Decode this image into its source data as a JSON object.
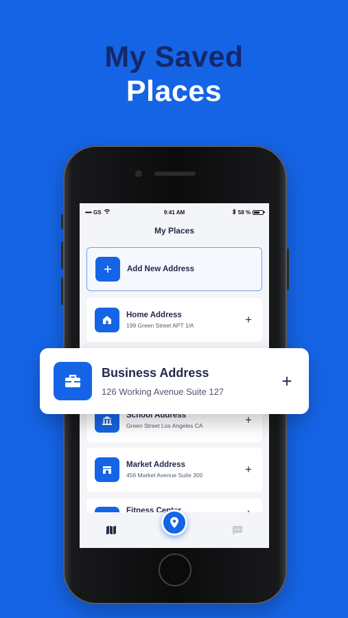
{
  "headline": {
    "line1": "My Saved",
    "line2": "Places"
  },
  "statusbar": {
    "carrier": "GS",
    "signal_dots": "•••••",
    "time": "9:41 AM",
    "battery": "58 %"
  },
  "screen": {
    "title": "My Places"
  },
  "add_card": {
    "label": "Add New Address",
    "icon": "plus-icon"
  },
  "places": [
    {
      "title": "Home Address",
      "subtitle": "199 Green Street APT 1/A",
      "icon": "home-icon"
    },
    {
      "title": "School Address",
      "subtitle": "Green Street Los Angeles CA",
      "icon": "school-icon"
    },
    {
      "title": "Market Address",
      "subtitle": "456 Market Avenue Suite 300",
      "icon": "store-icon"
    },
    {
      "title": "Fitness Center",
      "subtitle": "",
      "icon": "dumbbell-icon"
    }
  ],
  "featured": {
    "title": "Business Address",
    "subtitle": "126 Working Avenue Suite 127",
    "icon": "briefcase-icon"
  },
  "tabbar": {
    "items": [
      "map-icon",
      "location-pin-icon",
      "chat-icon"
    ]
  },
  "colors": {
    "brand": "#1564e6",
    "headline_dark": "#14286a",
    "text_dark": "#23294d"
  }
}
